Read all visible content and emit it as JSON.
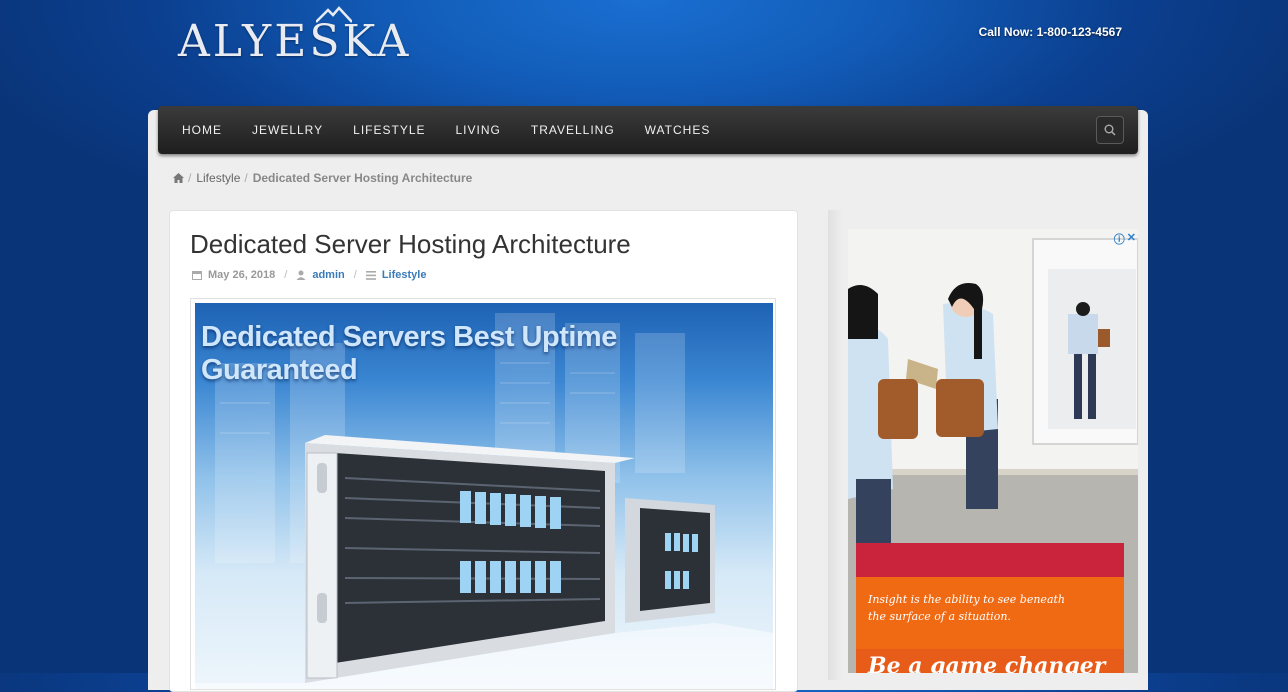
{
  "site": {
    "logo_text": "ALYESKA",
    "phone": "Call Now: 1-800-123-4567"
  },
  "nav": {
    "items": [
      "HOME",
      "JEWELLRY",
      "LIFESTYLE",
      "LIVING",
      "TRAVELLING",
      "WATCHES"
    ],
    "search_icon": "search-icon"
  },
  "breadcrumb": {
    "home_icon": "home-icon",
    "category": "Lifestyle",
    "current": "Dedicated Server Hosting Architecture"
  },
  "post": {
    "title": "Dedicated Server Hosting Architecture",
    "date": "May 26, 2018",
    "author": "admin",
    "category": "Lifestyle",
    "image_headline": "Dedicated Servers Best Uptime Guaranteed"
  },
  "ad": {
    "insight_line1": "Insight is the ability to see beneath",
    "insight_line2": "the surface of a situation.",
    "cta": "Be a game changer"
  }
}
